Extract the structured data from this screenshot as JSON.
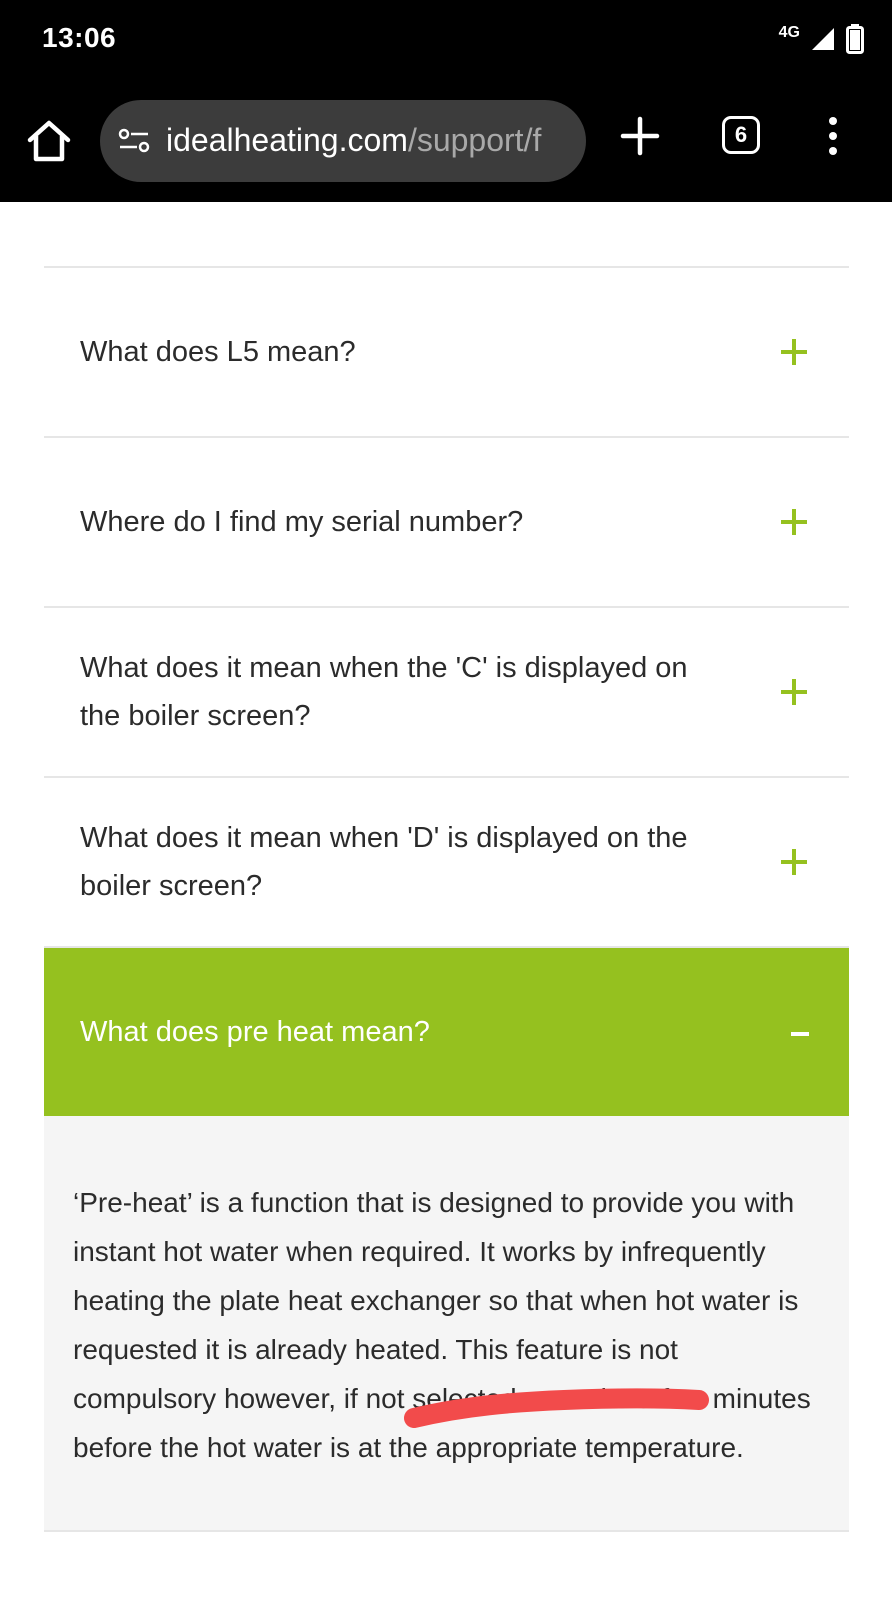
{
  "status_bar": {
    "time": "13:06",
    "network": "4G"
  },
  "browser": {
    "url_domain": "idealheating.com",
    "url_path": "/support/f",
    "tab_count": "6"
  },
  "faq": {
    "items": [
      {
        "question": "What does L5 mean?",
        "toggle": "+"
      },
      {
        "question": "Where do I find my serial number?",
        "toggle": "+"
      },
      {
        "question": "What does it mean when the 'C' is displayed on the boiler screen?",
        "toggle": "+"
      },
      {
        "question": "What does it mean when 'D' is displayed on the boiler screen?",
        "toggle": "+"
      }
    ],
    "open_item": {
      "question": "What does pre heat mean?",
      "toggle": "-",
      "answer": "‘Pre-heat’ is a function that is designed to provide you with instant hot water when required. It works by infrequently heating the plate heat exchanger so that when hot water is requested it is already heated. This feature is not compulsory however, if not selected can take a few minutes before the hot water is at the appropriate temperature."
    }
  },
  "colors": {
    "accent_green": "#95c11f",
    "annotation_red": "#f24b4b"
  }
}
